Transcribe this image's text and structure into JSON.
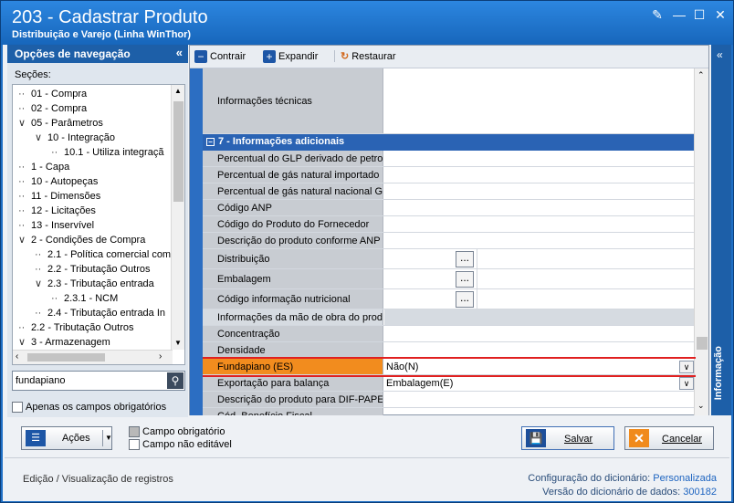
{
  "window": {
    "title": "203 - Cadastrar  Produto",
    "subtitle": "Distribuição e Varejo (Linha WinThor)"
  },
  "nav": {
    "header": "Opções de navegação",
    "sections_label": "Seções:",
    "tree": [
      {
        "label": "01 - Compra",
        "indent": 0,
        "prefix": "·"
      },
      {
        "label": "02 - Compra",
        "indent": 0,
        "prefix": "·"
      },
      {
        "label": "05 - Parâmetros",
        "indent": 0,
        "prefix": "v"
      },
      {
        "label": "10 - Integração",
        "indent": 1,
        "prefix": "v"
      },
      {
        "label": "10.1 - Utiliza integraçã",
        "indent": 2,
        "prefix": "·"
      },
      {
        "label": "1 - Capa",
        "indent": 0,
        "prefix": "·"
      },
      {
        "label": "10 - Autopeças",
        "indent": 0,
        "prefix": "·"
      },
      {
        "label": "11 - Dimensões",
        "indent": 0,
        "prefix": "·"
      },
      {
        "label": "12 - Licitações",
        "indent": 0,
        "prefix": "·"
      },
      {
        "label": "13 - Inservível",
        "indent": 0,
        "prefix": "·"
      },
      {
        "label": "2 - Condições de Compra",
        "indent": 0,
        "prefix": "v"
      },
      {
        "label": "2.1 - Política comercial com",
        "indent": 1,
        "prefix": "·"
      },
      {
        "label": "2.2 - Tributação Outros",
        "indent": 1,
        "prefix": "·"
      },
      {
        "label": "2.3 - Tributação entrada",
        "indent": 1,
        "prefix": "v"
      },
      {
        "label": "2.3.1 - NCM",
        "indent": 2,
        "prefix": "·"
      },
      {
        "label": "2.4 - Tributação entrada In",
        "indent": 1,
        "prefix": "·"
      },
      {
        "label": "2.2 - Tributação Outros",
        "indent": 0,
        "prefix": "·"
      },
      {
        "label": "3 - Armazenagem",
        "indent": 0,
        "prefix": "v"
      }
    ],
    "search_value": "fundapiano",
    "only_required_label": "Apenas os campos obrigatórios"
  },
  "toolbar": {
    "collapse": "Contrair",
    "expand": "Expandir",
    "restore": "Restaurar"
  },
  "grid": {
    "tech_info_label": "Informações técnicas",
    "category": "7 - Informações adicionais",
    "rows": [
      {
        "label": "Percentual do GLP derivado de petrol",
        "value": ""
      },
      {
        "label": "Percentual de gás natural importado (",
        "value": ""
      },
      {
        "label": "Percentual de gás natural nacional GL",
        "value": ""
      },
      {
        "label": "Código ANP",
        "value": ""
      },
      {
        "label": "Código do Produto do Fornecedor",
        "value": ""
      },
      {
        "label": "Descrição do produto conforme ANP",
        "value": ""
      },
      {
        "label": "Distribuição",
        "value": ""
      },
      {
        "label": "Embalagem",
        "value": ""
      },
      {
        "label": "Código informação nutricional",
        "value": ""
      },
      {
        "label": "Informações da mão de obra do prod",
        "value": ""
      },
      {
        "label": "Concentração",
        "value": ""
      },
      {
        "label": "Densidade",
        "value": ""
      },
      {
        "label": "Fundapiano (ES)",
        "value": "Não(N)"
      },
      {
        "label": "Exportação para balança",
        "value": "Embalagem(E)"
      },
      {
        "label": "Descrição do produto para DIF-PAPEL",
        "value": ""
      },
      {
        "label": "Cód. Benefício Fiscal",
        "value": ""
      }
    ],
    "dots_label": "...",
    "highlight_color": "#f28c1e",
    "highlight_border": "#e02020"
  },
  "sidetab": {
    "label": "Informação"
  },
  "bottom": {
    "actions": "Ações",
    "legend_required": "Campo obrigatório",
    "legend_readonly": "Campo não editável",
    "save": "Salvar",
    "cancel": "Cancelar",
    "mode": "Edição / Visualização de registros",
    "dict_config_label": "Configuração do dicionário:",
    "dict_config_value": "Personalizada",
    "dict_version_label": "Versão do dicionário de dados:",
    "dict_version_value": "300182"
  }
}
